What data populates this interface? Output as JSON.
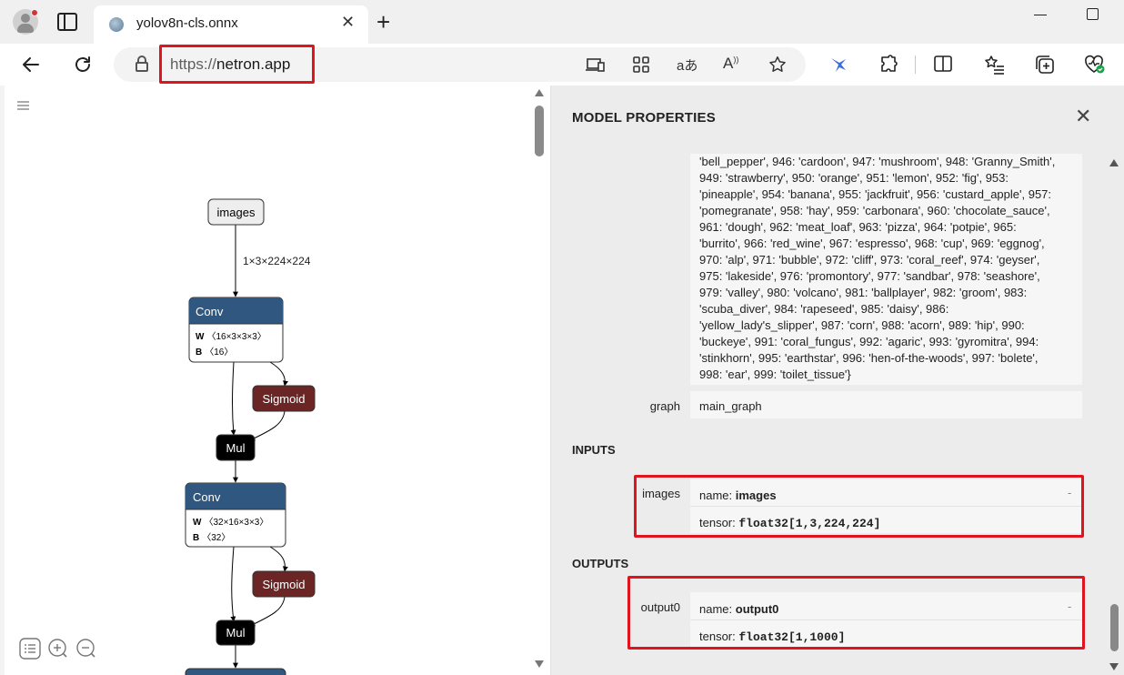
{
  "browser": {
    "tab_title": "yolov8n-cls.onnx",
    "tab_close": "✕",
    "new_tab": "+",
    "url_protocol": "https://",
    "url_host": "netron.app"
  },
  "graph": {
    "input_node": "images",
    "edge_label": "1×3×224×224",
    "conv1": {
      "name": "Conv",
      "w_label": "W",
      "w_shape": "〈16×3×3×3〉",
      "b_label": "B",
      "b_shape": "〈16〉"
    },
    "sigmoid1": "Sigmoid",
    "mul1": "Mul",
    "conv2": {
      "name": "Conv",
      "w_label": "W",
      "w_shape": "〈32×16×3×3〉",
      "b_label": "B",
      "b_shape": "〈32〉"
    },
    "sigmoid2": "Sigmoid",
    "mul2": "Mul"
  },
  "properties": {
    "title": "MODEL PROPERTIES",
    "close": "✕",
    "metadata_text": "'bell_pepper', 946: 'cardoon', 947: 'mushroom', 948: 'Granny_Smith',\n949: 'strawberry', 950: 'orange', 951: 'lemon', 952: 'fig', 953:\n'pineapple', 954: 'banana', 955: 'jackfruit', 956: 'custard_apple', 957:\n'pomegranate', 958: 'hay', 959: 'carbonara', 960: 'chocolate_sauce',\n961: 'dough', 962: 'meat_loaf', 963: 'pizza', 964: 'potpie', 965:\n'burrito', 966: 'red_wine', 967: 'espresso', 968: 'cup', 969: 'eggnog',\n970: 'alp', 971: 'bubble', 972: 'cliff', 973: 'coral_reef', 974: 'geyser',\n975: 'lakeside', 976: 'promontory', 977: 'sandbar', 978: 'seashore',\n979: 'valley', 980: 'volcano', 981: 'ballplayer', 982: 'groom', 983:\n'scuba_diver', 984: 'rapeseed', 985: 'daisy', 986:\n'yellow_lady's_slipper', 987: 'corn', 988: 'acorn', 989: 'hip', 990:\n'buckeye', 991: 'coral_fungus', 992: 'agaric', 993: 'gyromitra', 994:\n'stinkhorn', 995: 'earthstar', 996: 'hen-of-the-woods', 997: 'bolete',\n998: 'ear', 999: 'toilet_tissue'}",
    "graph_label": "graph",
    "graph_value": "main_graph",
    "inputs_title": "INPUTS",
    "input": {
      "label": "images",
      "name_prefix": "name: ",
      "name": "images",
      "tensor_prefix": "tensor: ",
      "tensor": "float32[1,3,224,224]",
      "dash": "-"
    },
    "outputs_title": "OUTPUTS",
    "output": {
      "label": "output0",
      "name_prefix": "name: ",
      "name": "output0",
      "tensor_prefix": "tensor: ",
      "tensor": "float32[1,1000]",
      "dash": "-"
    }
  },
  "colors": {
    "conv_header": "#30577f",
    "sigmoid": "#6b2525",
    "mul": "#000000",
    "highlight": "#e0141e"
  }
}
